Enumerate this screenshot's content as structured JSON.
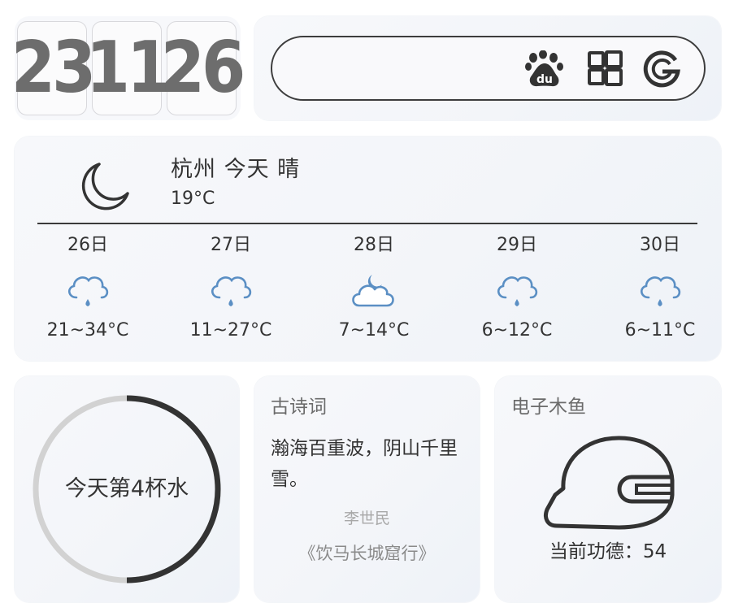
{
  "clock": {
    "hours": "23",
    "minutes": "11",
    "seconds": "26"
  },
  "search": {
    "placeholder": "",
    "engines": [
      "baidu-icon",
      "bing-windows-icon",
      "google-icon"
    ]
  },
  "weather": {
    "title": "杭州 今天 晴",
    "temp": "19°C",
    "icon": "moon-icon",
    "forecast": [
      {
        "date": "26日",
        "icon": "rain-cloud-icon",
        "range": "21~34°C"
      },
      {
        "date": "27日",
        "icon": "rain-cloud-icon",
        "range": "11~27°C"
      },
      {
        "date": "28日",
        "icon": "cloudy-night-icon",
        "range": "7~14°C"
      },
      {
        "date": "29日",
        "icon": "rain-cloud-icon",
        "range": "6~12°C"
      },
      {
        "date": "30日",
        "icon": "rain-cloud-icon",
        "range": "6~11°C"
      }
    ]
  },
  "water": {
    "label": "今天第4杯水",
    "progress": 0.5
  },
  "poem": {
    "heading": "古诗词",
    "line": "瀚海百重波，阴山千里雪。",
    "author": "李世民",
    "title": "《饮马长城窟行》"
  },
  "muyu": {
    "heading": "电子木鱼",
    "merit": "当前功德：54"
  },
  "colors": {
    "accent_dark": "#333333",
    "ring_track": "#d2d2d2",
    "icon_blue": "#5b8fc4"
  }
}
